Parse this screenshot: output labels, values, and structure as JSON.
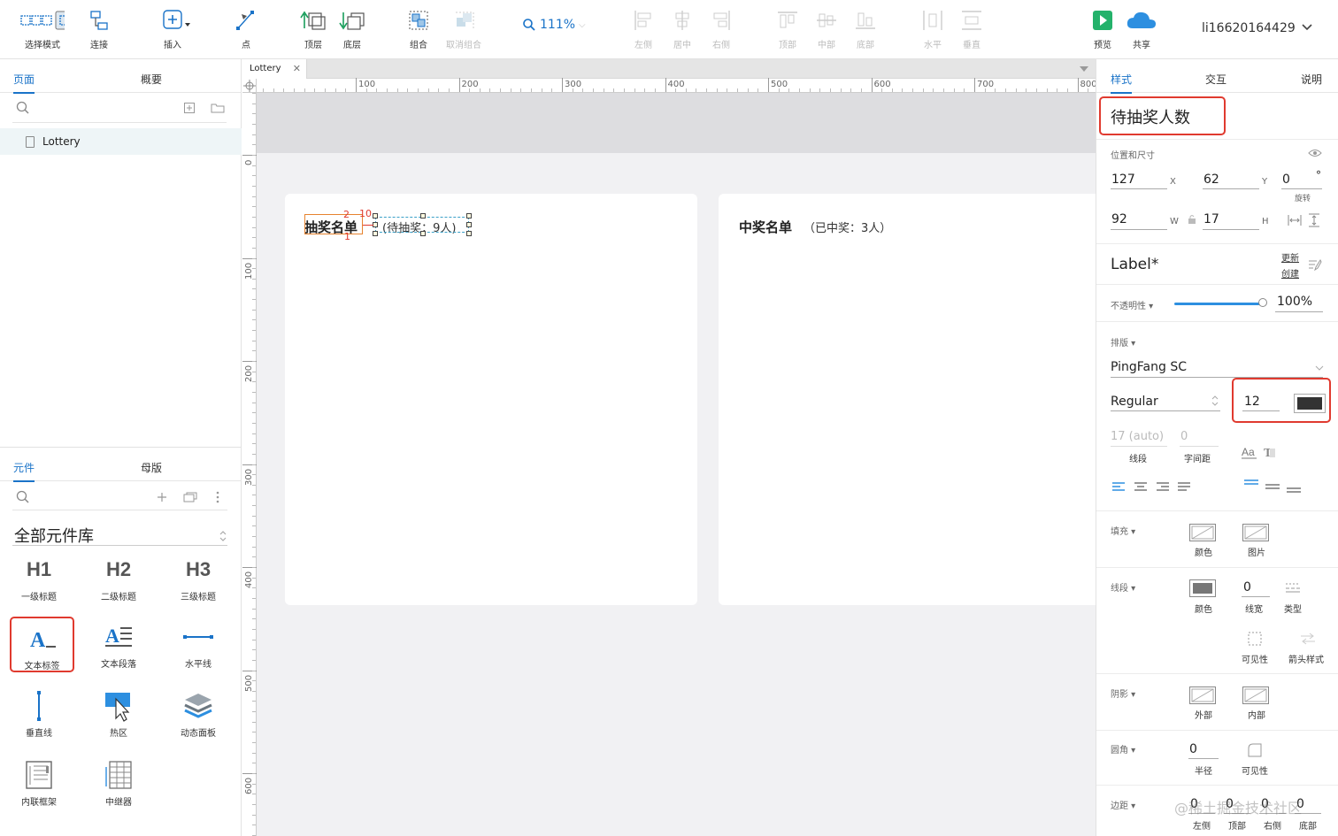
{
  "toolbar": {
    "select_mode": "选择模式",
    "connect": "连接",
    "insert": "插入",
    "point": "点",
    "top_layer": "顶层",
    "bottom_layer": "底层",
    "group": "组合",
    "ungroup": "取消组合",
    "zoom": "111%",
    "align_left": "左侧",
    "align_center": "居中",
    "align_right": "右侧",
    "align_top": "顶部",
    "align_middle": "中部",
    "align_bottom": "底部",
    "distribute_h": "水平",
    "distribute_v": "垂直",
    "preview": "预览",
    "share": "共享",
    "username": "li16620164429",
    "accent": "#1a73c8"
  },
  "left": {
    "tab_pages": "页面",
    "tab_outline": "概要",
    "pages": [
      "Lottery"
    ],
    "tab_widgets": "元件",
    "tab_masters": "母版",
    "library_name": "全部元件库",
    "widgets": [
      {
        "glyph": "H1",
        "label": "一级标题"
      },
      {
        "glyph": "H2",
        "label": "二级标题"
      },
      {
        "glyph": "H3",
        "label": "三级标题"
      },
      {
        "glyph": "A_",
        "label": "文本标签"
      },
      {
        "glyph": "A≡",
        "label": "文本段落"
      },
      {
        "glyph": "—",
        "label": "水平线"
      },
      {
        "glyph": "|",
        "label": "垂直线"
      },
      {
        "glyph": "hotspot",
        "label": "热区"
      },
      {
        "glyph": "layers",
        "label": "动态面板"
      },
      {
        "glyph": "iframe",
        "label": "内联框架"
      },
      {
        "glyph": "repeater",
        "label": "中继器"
      }
    ]
  },
  "canvas": {
    "doc_tab": "Lottery",
    "ruler_h": [
      "100",
      "200",
      "300",
      "400",
      "500",
      "600",
      "700",
      "800"
    ],
    "ruler_v": [
      "0",
      "100",
      "200",
      "300",
      "400",
      "500",
      "600"
    ],
    "card1": {
      "title": "抽奖名单",
      "sub": "(待抽奖：9人)"
    },
    "card2": {
      "title": "中奖名单",
      "sub": "（已中奖：3人）"
    },
    "guide_top": "2",
    "guide_right": "10",
    "guide_bottom": "1"
  },
  "right": {
    "tab_style": "样式",
    "tab_interaction": "交互",
    "tab_notes": "说明",
    "widget_name": "待抽奖人数",
    "pos_size_label": "位置和尺寸",
    "x": "127",
    "x_label": "X",
    "y": "62",
    "y_label": "Y",
    "rotation": "0",
    "rotation_unit": "°",
    "rotation_label": "旋转",
    "w": "92",
    "w_label": "W",
    "h": "17",
    "h_label": "H",
    "style_name": "Label*",
    "update": "更新",
    "create": "创建",
    "opacity_label": "不透明性",
    "opacity": "100%",
    "typography_label": "排版",
    "font_family": "PingFang SC",
    "font_weight": "Regular",
    "font_size": "12",
    "font_color": "#333333",
    "line_height": "17 (auto)",
    "letter_spacing": "0",
    "line_label": "线段",
    "spacing_label": "字间距",
    "fill_label": "填充",
    "fill_color": "颜色",
    "fill_image": "图片",
    "border_label": "线段",
    "border_color": "颜色",
    "border_width": "0",
    "border_width_label": "线宽",
    "border_type": "类型",
    "visibility": "可见性",
    "arrow_style": "箭头样式",
    "shadow_label": "阴影",
    "shadow_outer": "外部",
    "shadow_inner": "内部",
    "corner_label": "圆角",
    "corner_radius": "0",
    "corner_radius_label": "半径",
    "corner_visibility": "可见性",
    "padding_label": "边距",
    "padding": [
      "0",
      "0",
      "0",
      "0"
    ],
    "padding_left": "左侧",
    "padding_top": "顶部",
    "padding_right": "右侧",
    "padding_bottom": "底部",
    "watermark": "@稀土掘金技术社区"
  }
}
